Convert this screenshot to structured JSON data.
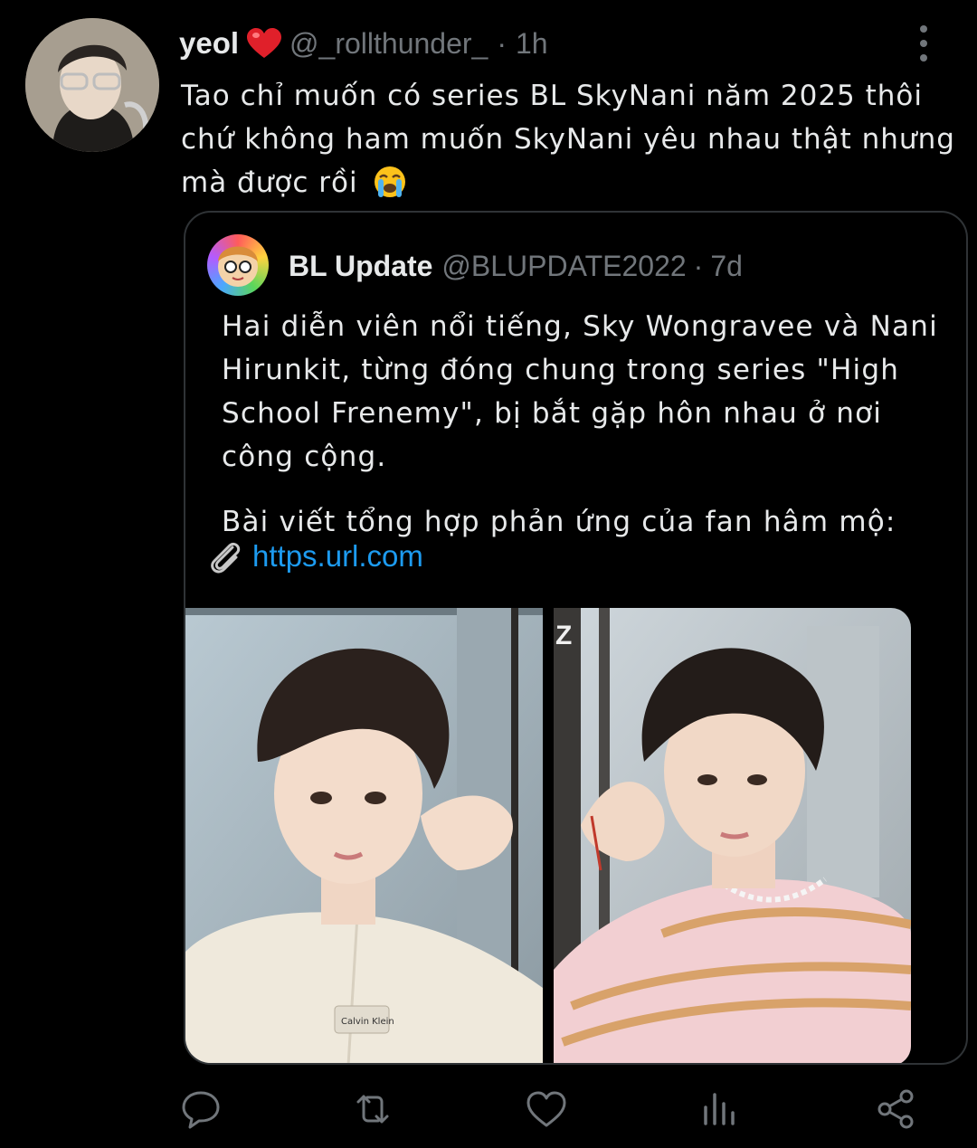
{
  "tweet": {
    "author_name": "yeol",
    "handle": "@_rollthunder_",
    "separator": "·",
    "time": "1h",
    "text": "Tao chỉ muốn có series BL SkyNani năm 2025 thôi chứ không ham muốn SkyNani yêu nhau thật nhưng mà được rồi",
    "author_emoji": "red-heart-icon",
    "text_emoji": "loudly-crying-face-icon"
  },
  "quote": {
    "author_name": "BL Update",
    "handle": "@BLUPDATE2022",
    "separator": "·",
    "time": "7d",
    "text": "Hai diễn viên nổi tiếng, Sky Wongravee và Nani Hirunkit, từng đóng chung trong series \"High School Frenemy\", bị bắt gặp hôn nhau ở nơi công cộng.",
    "text2": "Bài viết tổng hợp phản ứng của fan hâm mộ:",
    "link": "https.url.com",
    "link_icon": "paperclip-icon",
    "photo_right_overlay": "Z",
    "photo_left_shirt_label": "Calvin Klein"
  },
  "actions": [
    "reply-icon",
    "retweet-icon",
    "like-icon",
    "analytics-icon",
    "share-icon"
  ],
  "colors": {
    "background": "#000000",
    "text": "#e7e9ea",
    "muted": "#71767b",
    "link": "#1d9bf0",
    "border": "#2f3336"
  }
}
